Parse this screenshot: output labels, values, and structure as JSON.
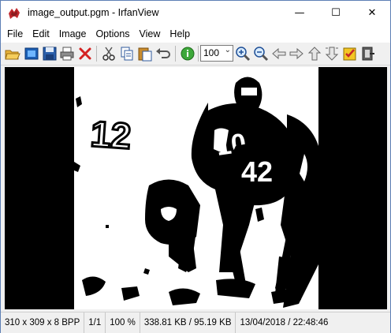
{
  "window": {
    "title": "image_output.pgm - IrfanView",
    "minimize_glyph": "—",
    "maximize_glyph": "☐",
    "close_glyph": "✕"
  },
  "menu": {
    "items": [
      {
        "label": "File"
      },
      {
        "label": "Edit"
      },
      {
        "label": "Image"
      },
      {
        "label": "Options"
      },
      {
        "label": "View"
      },
      {
        "label": "Help"
      }
    ]
  },
  "toolbar": {
    "zoom_value": "100",
    "icons": [
      "open-icon",
      "slideshow-icon",
      "save-icon",
      "print-icon",
      "delete-icon",
      "cut-icon",
      "copy-icon",
      "paste-icon",
      "undo-icon",
      "info-icon",
      "zoom-in-icon",
      "zoom-out-icon",
      "previous-icon",
      "next-icon",
      "first-icon",
      "last-icon",
      "settings-icon",
      "exit-icon"
    ]
  },
  "photo": {
    "jersey_left": "12",
    "jersey_center": "10",
    "jersey_right": "42"
  },
  "status": {
    "dimensions": "310 x 309 x 8 BPP",
    "page": "1/1",
    "zoom": "100 %",
    "size": "338.81 KB / 95.19 KB",
    "datetime": "13/04/2018 / 22:48:46"
  },
  "colors": {
    "accent": "#0078d7",
    "viewer_bg": "#000000"
  }
}
